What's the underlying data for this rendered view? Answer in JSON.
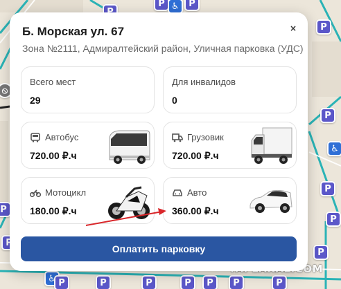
{
  "card": {
    "title": "Б. Морская ул. 67",
    "subtitle": "Зона №2111, Адмиралтейский район, Уличная парковка (УДС)",
    "close_label": "×"
  },
  "stats": {
    "total": {
      "label": "Всего мест",
      "value": "29"
    },
    "disabled": {
      "label": "Для инвалидов",
      "value": "0"
    }
  },
  "tariffs": [
    {
      "label": "Автобус",
      "price": "720.00 ₽.ч",
      "icon": "bus-icon"
    },
    {
      "label": "Грузовик",
      "price": "720.00 ₽.ч",
      "icon": "truck-icon"
    },
    {
      "label": "Мотоцикл",
      "price": "180.00 ₽.ч",
      "icon": "motorcycle-icon"
    },
    {
      "label": "Авто",
      "price": "360.00 ₽.ч",
      "icon": "car-icon"
    }
  ],
  "pay_button": {
    "label": "Оплатить парковку"
  },
  "watermark": "YAPLAKAL.COM",
  "colors": {
    "primary": "#2a56a2",
    "marker": "#5b57c9",
    "arrow": "#d9262a"
  }
}
